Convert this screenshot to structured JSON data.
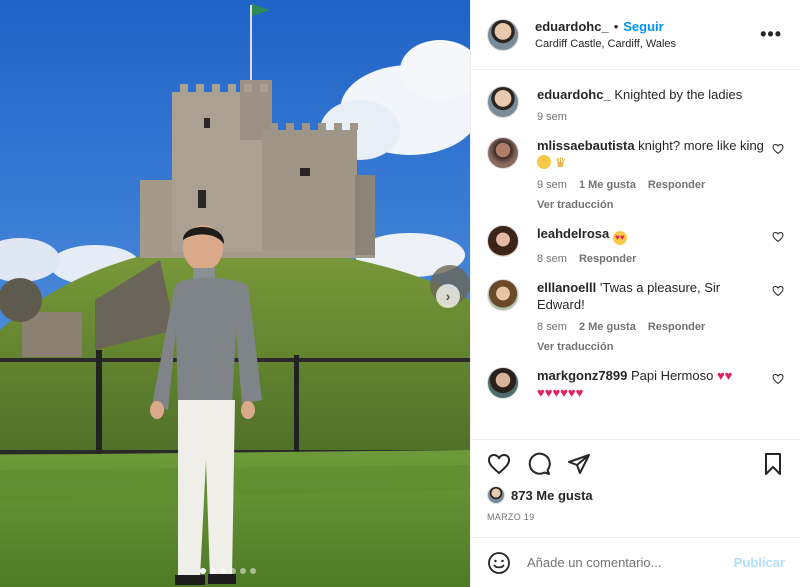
{
  "post": {
    "author": "eduardohc_",
    "separator": "•",
    "follow_label": "Seguir",
    "location": "Cardiff Castle, Cardiff, Wales",
    "more_label": "•••"
  },
  "caption": {
    "author": "eduardohc_",
    "text": "Knighted by the ladies",
    "time": "9 sem"
  },
  "comments": [
    {
      "author": "mlissaebautista",
      "text": "knight? more like king",
      "emojis": [
        "grinning-face",
        "crown"
      ],
      "time": "9 sem",
      "likes": "1 Me gusta",
      "reply": "Responder",
      "translate": "Ver traducción"
    },
    {
      "author": "leahdelrosa",
      "text": "",
      "emojis": [
        "heart-eyes-face"
      ],
      "time": "8 sem",
      "reply": "Responder"
    },
    {
      "author": "elllanoelll",
      "text": "'Twas a pleasure, Sir Edward!",
      "time": "8 sem",
      "likes": "2 Me gusta",
      "reply": "Responder",
      "translate": "Ver traducción"
    },
    {
      "author": "markgonz7899",
      "text": "Papi Hermoso",
      "emojis": [
        "red-heart",
        "red-heart",
        "red-heart",
        "red-heart",
        "red-heart",
        "red-heart",
        "red-heart",
        "red-heart"
      ]
    }
  ],
  "actions": {
    "likes_count": "873 Me gusta",
    "date": "MARZO 19"
  },
  "composer": {
    "placeholder": "Añade un comentario...",
    "publish_label": "Publicar"
  },
  "colors": {
    "accent": "#0095f6",
    "publish_disabled": "#b2dffc",
    "muted": "#737373",
    "heart": "#e0245e"
  }
}
